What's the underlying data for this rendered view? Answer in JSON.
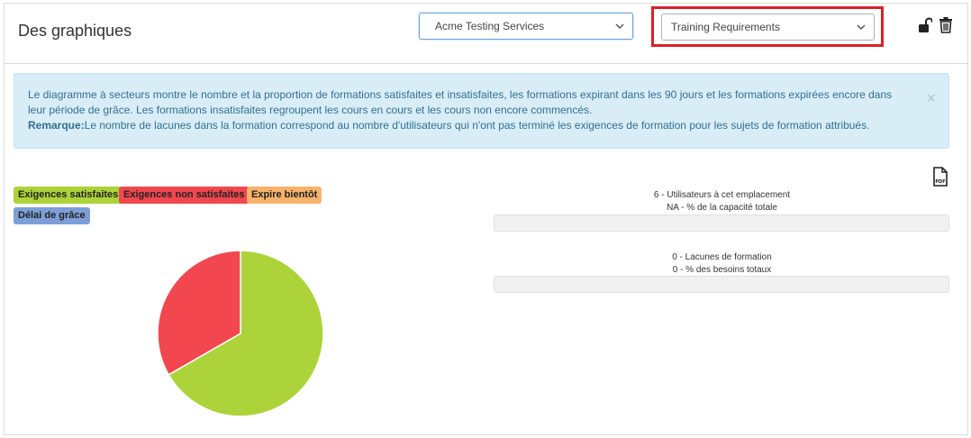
{
  "header": {
    "title": "Des graphiques",
    "company_select": "Acme Testing Services",
    "report_select": "Training Requirements"
  },
  "alert": {
    "text": "Le diagramme à secteurs montre le nombre et la proportion de formations satisfaites et insatisfaites, les formations expirant dans les 90 jours et les formations expirées encore dans leur période de grâce. Les formations insatisfaites regroupent les cours en cours et les cours non encore commencés.",
    "note_label": "Remarque:",
    "note_text": "Le nombre de lacunes dans la formation correspond au nombre d'utilisateurs qui n'ont pas terminé les exigences de formation pour les sujets de formation attribués.",
    "close": "×"
  },
  "colors": {
    "satisfied": "#acd33a",
    "unsatisfied": "#f2474f",
    "expiring": "#f7b26b",
    "grace": "#7d9fd9",
    "highlight": "#d9202a"
  },
  "legend": [
    {
      "label": "Exigences satisfaites",
      "color": "#acd33a"
    },
    {
      "label": "Exigences non satisfaites",
      "color": "#f2474f"
    },
    {
      "label": "Expire bientôt",
      "color": "#f7b26b"
    },
    {
      "label": "Délai de grâce",
      "color": "#7d9fd9"
    }
  ],
  "stats": {
    "users_line": "6 - Utilisateurs à cet emplacement",
    "capacity_line": "NA - % de la capacité totale",
    "capacity_progress": 0,
    "gaps_line": "0 - Lacunes de formation",
    "needs_line": "0 - % des besoins totaux",
    "needs_progress": 0
  },
  "chart_data": {
    "type": "pie",
    "slices": [
      {
        "category": "Exigences satisfaites",
        "value": 66.7,
        "color": "#acd33a"
      },
      {
        "category": "Exigences non satisfaites",
        "value": 33.3,
        "color": "#f2474f"
      }
    ]
  }
}
